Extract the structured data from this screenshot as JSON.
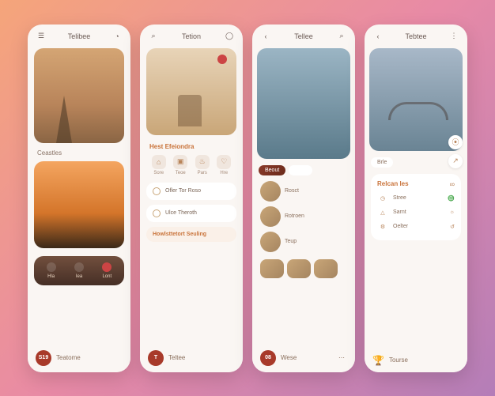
{
  "screens": [
    {
      "title": "Telibee",
      "section1": "Ceastles",
      "stats": [
        "Hla",
        "Iea",
        "Lont"
      ],
      "nav_badge": "S19",
      "nav_label": "Teatome"
    },
    {
      "title": "Tetion",
      "chip": "Hest Efeiondra",
      "icons": [
        "Sore",
        "Teoe",
        "Pars",
        "Hre"
      ],
      "list1": "Ofler Tor Roso",
      "list2": "Ulce Theroth",
      "banner": "Howlsttetort Seuling",
      "nav_badge": "T",
      "nav_label": "Teltee"
    },
    {
      "title": "Tellee",
      "pill_active": "Beout",
      "pill2": "",
      "row1": "Rosct",
      "row2": "Rotroen",
      "row3": "Teup",
      "nav_badge": "08",
      "nav_label": "Wese"
    },
    {
      "title": "Tebtee",
      "pill1": "Brle",
      "card_title": "Relcan les",
      "lines": [
        "Stree",
        "Sarnt",
        "Oelter"
      ],
      "nav_label": "Tourse"
    }
  ]
}
